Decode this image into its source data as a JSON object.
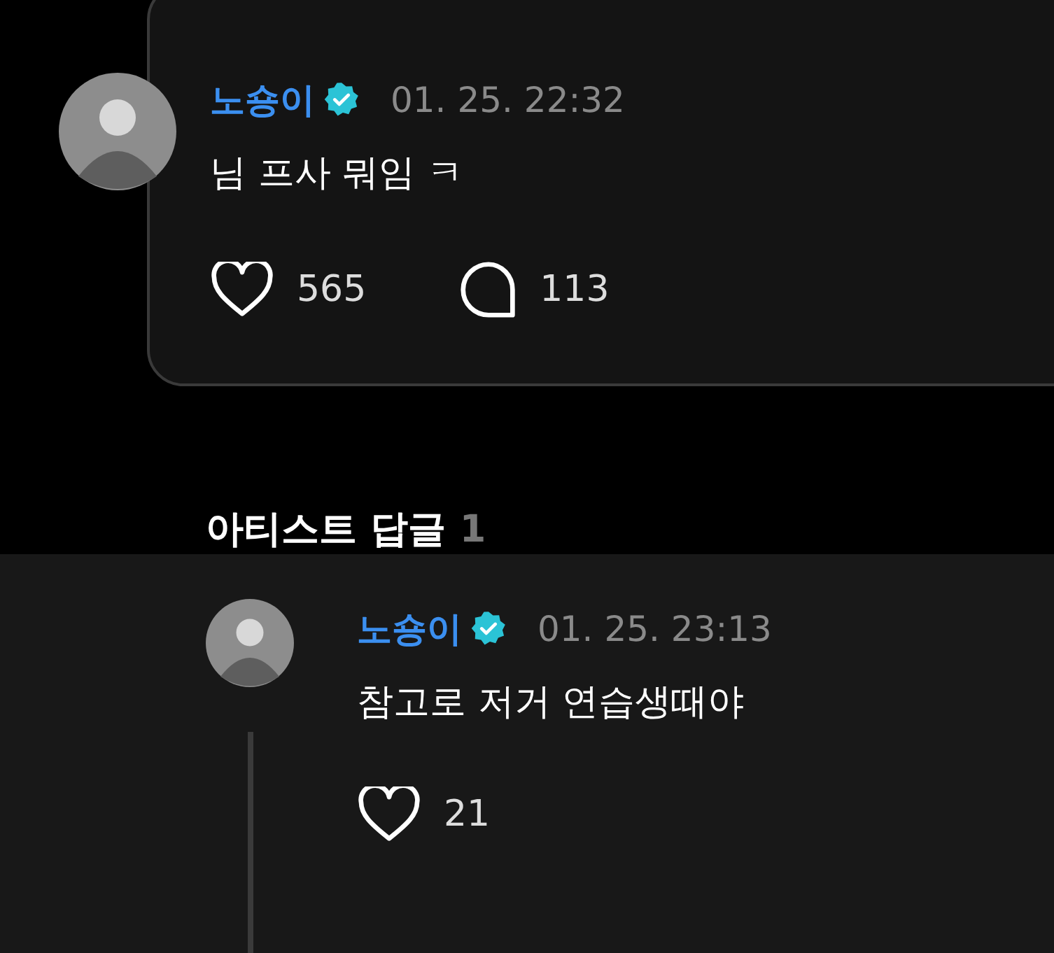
{
  "comment": {
    "author": "노숑이",
    "verified": true,
    "time": "01. 25. 22:32",
    "text": "님 프사 뭐임 ㅋ",
    "likes": "565",
    "replies": "113"
  },
  "replies_section": {
    "title": "아티스트 답글",
    "count": "1"
  },
  "replies": [
    {
      "author": "노숑이",
      "verified": true,
      "time": "01. 25. 23:13",
      "text": "참고로 저거 연습생때야",
      "likes": "21"
    }
  ]
}
